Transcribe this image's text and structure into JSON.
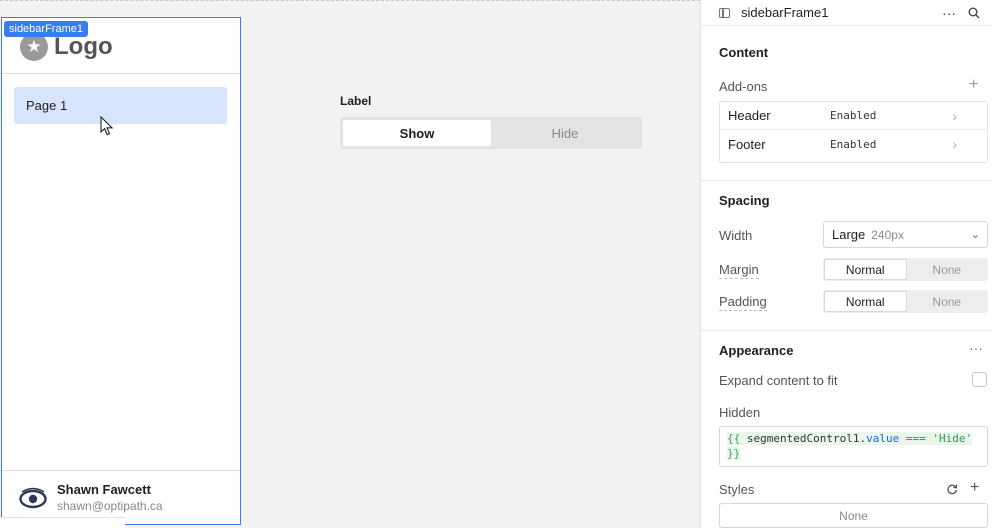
{
  "canvas": {
    "frame_badge": "sidebarFrame1",
    "logo": {
      "icon": "star-icon",
      "text": "Logo"
    },
    "nav": [
      {
        "label": "Page 1",
        "selected": true
      }
    ],
    "segmented": {
      "label": "Label",
      "options": [
        "Show",
        "Hide"
      ],
      "selected": "Show"
    },
    "user": {
      "name": "Shawn Fawcett",
      "email": "shawn@optipath.ca",
      "avatar": "eye-logo-icon"
    }
  },
  "inspector": {
    "title": "sidebarFrame1",
    "sections": {
      "content": {
        "title": "Content",
        "addons_label": "Add-ons",
        "addons": [
          {
            "name": "Header",
            "value": "Enabled"
          },
          {
            "name": "Footer",
            "value": "Enabled"
          }
        ]
      },
      "spacing": {
        "title": "Spacing",
        "width_label": "Width",
        "width_value": "Large",
        "width_sub": "240px",
        "margin_label": "Margin",
        "margin_options": [
          "Normal",
          "None"
        ],
        "margin_selected": "Normal",
        "padding_label": "Padding",
        "padding_options": [
          "Normal",
          "None"
        ],
        "padding_selected": "Normal"
      },
      "appearance": {
        "title": "Appearance",
        "expand_label": "Expand content to fit",
        "expand_checked": false,
        "hidden_label": "Hidden",
        "hidden_code": {
          "open": "{{",
          "ident": "segmentedControl1",
          "dot": ".",
          "prop": "value",
          "op": "===",
          "str": "'Hide'",
          "close": "}}"
        },
        "styles_label": "Styles",
        "styles_value": "None"
      }
    }
  },
  "colors": {
    "accent": "#3b7bf0",
    "nav_selected": "#d6e4fd"
  }
}
